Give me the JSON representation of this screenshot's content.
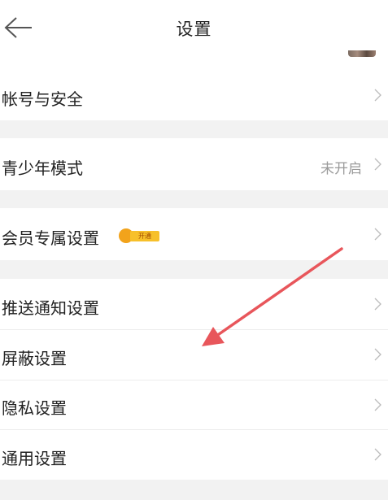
{
  "header": {
    "title": "设置",
    "back_icon": "back-arrow-icon"
  },
  "rows": [
    {
      "label": "帐号与安全"
    },
    {
      "label": "青少年模式",
      "value": "未开启"
    },
    {
      "label": "会员专属设置",
      "badge": "开通"
    },
    {
      "label": "推送通知设置"
    },
    {
      "label": "屏蔽设置"
    },
    {
      "label": "隐私设置"
    },
    {
      "label": "通用设置"
    }
  ],
  "annotation": {
    "icon": "red-arrow-icon",
    "color": "#e8565b",
    "points_to": "屏蔽设置"
  },
  "colors": {
    "background": "#f2f2f2",
    "row": "#ffffff",
    "text": "#222222",
    "muted": "#9a9a9a",
    "accent": "#f2a31b"
  }
}
